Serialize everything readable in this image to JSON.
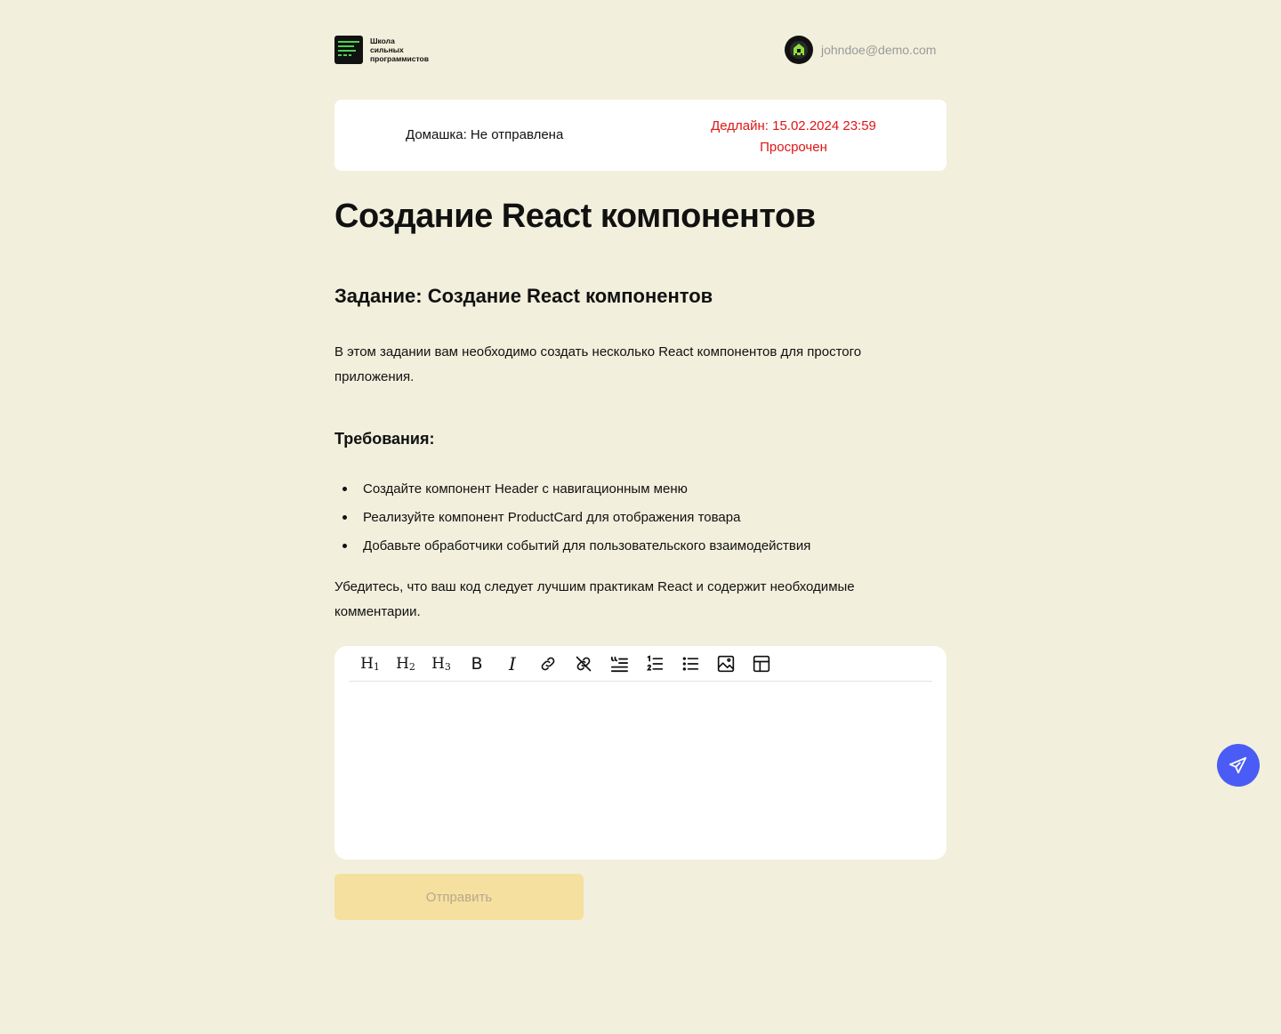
{
  "header": {
    "logo_lines": [
      "Школа",
      "сильных",
      "программистов"
    ],
    "user_email": "johndoe@demo.com"
  },
  "status": {
    "homework_status": "Домашка: Не отправлена",
    "deadline": "Дедлайн: 15.02.2024 23:59",
    "overdue": "Просрочен"
  },
  "lesson": {
    "title": "Создание React компонентов",
    "task_title": "Задание: Создание React компонентов",
    "intro": "В этом задании вам необходимо создать несколько React компонентов для простого приложения.",
    "requirements_title": "Требования:",
    "requirements": [
      "Создайте компонент Header с навигационным меню",
      "Реализуйте компонент ProductCard для отображения товара",
      "Добавьте обработчики событий для пользовательского взаимодействия"
    ],
    "outro": "Убедитесь, что ваш код следует лучшим практикам React и содержит необходимые комментарии."
  },
  "editor": {
    "toolbar": [
      "heading-1",
      "heading-2",
      "heading-3",
      "bold",
      "italic",
      "link",
      "unlink",
      "blockquote",
      "ordered-list",
      "bullet-list",
      "image",
      "table"
    ],
    "h1": "H",
    "h1_sub": "1",
    "h2": "H",
    "h2_sub": "2",
    "h3": "H",
    "h3_sub": "3",
    "bold": "B",
    "italic": "I",
    "content": ""
  },
  "actions": {
    "submit_label": "Отправить"
  },
  "colors": {
    "background": "#f2efdc",
    "deadline_red": "#e01515",
    "submit_disabled": "#f5e0a0",
    "fab_blue": "#4a5cf5",
    "logo_green": "#4bd14b"
  }
}
